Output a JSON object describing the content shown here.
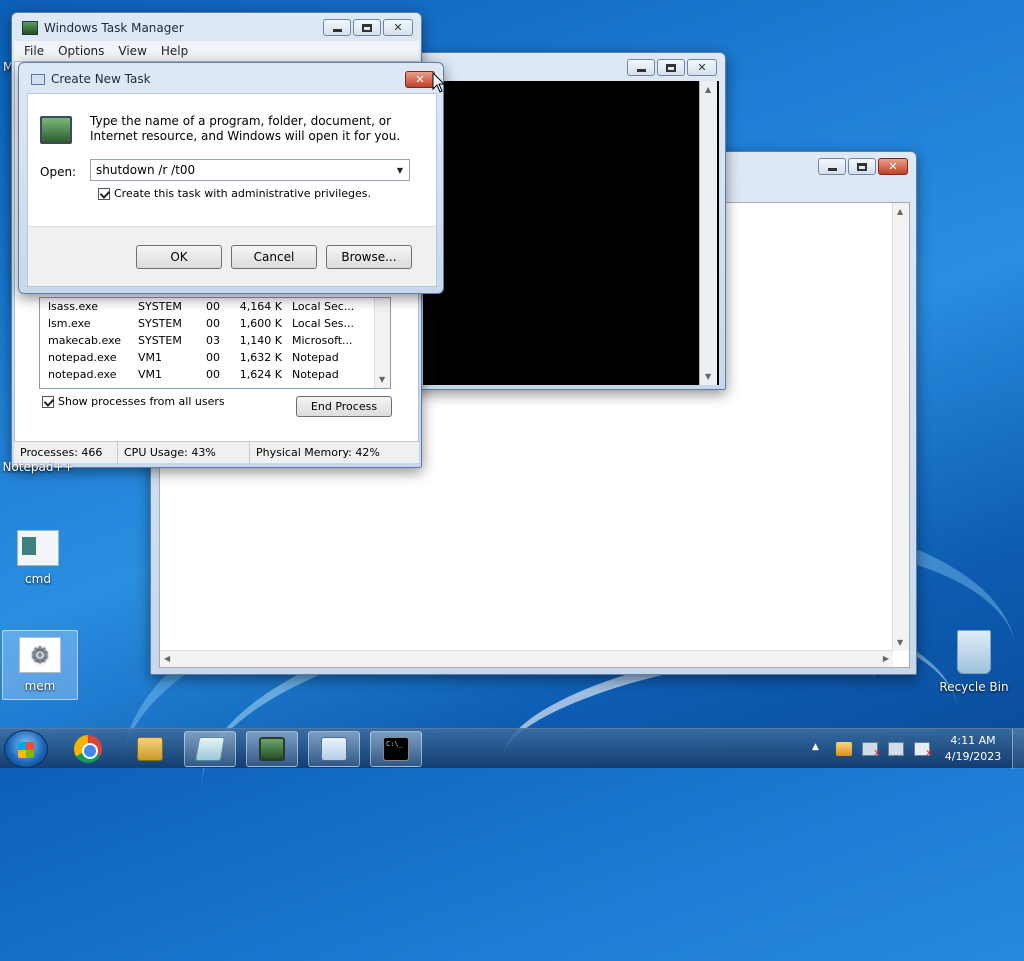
{
  "desktop": {
    "icons": [
      {
        "label": "Notepad++",
        "icon": "notepadpp-icon"
      },
      {
        "label": "cmd",
        "icon": "cmd-icon"
      },
      {
        "label": "mem",
        "icon": "gear-icon"
      },
      {
        "label": "Recycle Bin",
        "icon": "recycle-bin-icon"
      }
    ],
    "partial_label": "M"
  },
  "taskmgr": {
    "title": "Windows Task Manager",
    "menu": [
      "File",
      "Options",
      "View",
      "Help"
    ],
    "processes": [
      {
        "name": "lsass.exe",
        "user": "SYSTEM",
        "cpu": "00",
        "mem": "4,164 K",
        "desc": "Local Sec..."
      },
      {
        "name": "lsm.exe",
        "user": "SYSTEM",
        "cpu": "00",
        "mem": "1,600 K",
        "desc": "Local Ses..."
      },
      {
        "name": "makecab.exe",
        "user": "SYSTEM",
        "cpu": "03",
        "mem": "1,140 K",
        "desc": "Microsoft..."
      },
      {
        "name": "notepad.exe",
        "user": "VM1",
        "cpu": "00",
        "mem": "1,632 K",
        "desc": "Notepad"
      },
      {
        "name": "notepad.exe",
        "user": "VM1",
        "cpu": "00",
        "mem": "1,624 K",
        "desc": "Notepad"
      }
    ],
    "show_all_label": "Show processes from all users",
    "show_all_checked": true,
    "end_process_label": "End Process",
    "status": {
      "processes": "Processes: 466",
      "cpu": "CPU Usage: 43%",
      "memory": "Physical Memory: 42%"
    }
  },
  "new_task": {
    "title": "Create New Task",
    "description": "Type the name of a program, folder, document, or Internet resource, and Windows will open it for you.",
    "open_label": "Open:",
    "open_value": "shutdown /r /t00",
    "admin_label": "Create this task with administrative privileges.",
    "admin_checked": true,
    "ok_label": "OK",
    "cancel_label": "Cancel",
    "browse_label": "Browse..."
  },
  "taskbar": {
    "pinned": [
      {
        "name": "chrome",
        "icon": "chrome-icon"
      },
      {
        "name": "explorer",
        "icon": "folder-icon"
      },
      {
        "name": "notepad",
        "icon": "notepad-icon"
      },
      {
        "name": "taskmgr",
        "icon": "task-manager-icon"
      },
      {
        "name": "newtask",
        "icon": "run-dialog-icon"
      },
      {
        "name": "console",
        "icon": "console-icon"
      }
    ],
    "console_glyph": "C:\\_",
    "clock_time": "4:11 AM",
    "clock_date": "4/19/2023"
  },
  "colors": {
    "close_button": "#c2402a",
    "console_bg": "#000000",
    "desktop_blue": "#1f7fd6"
  }
}
